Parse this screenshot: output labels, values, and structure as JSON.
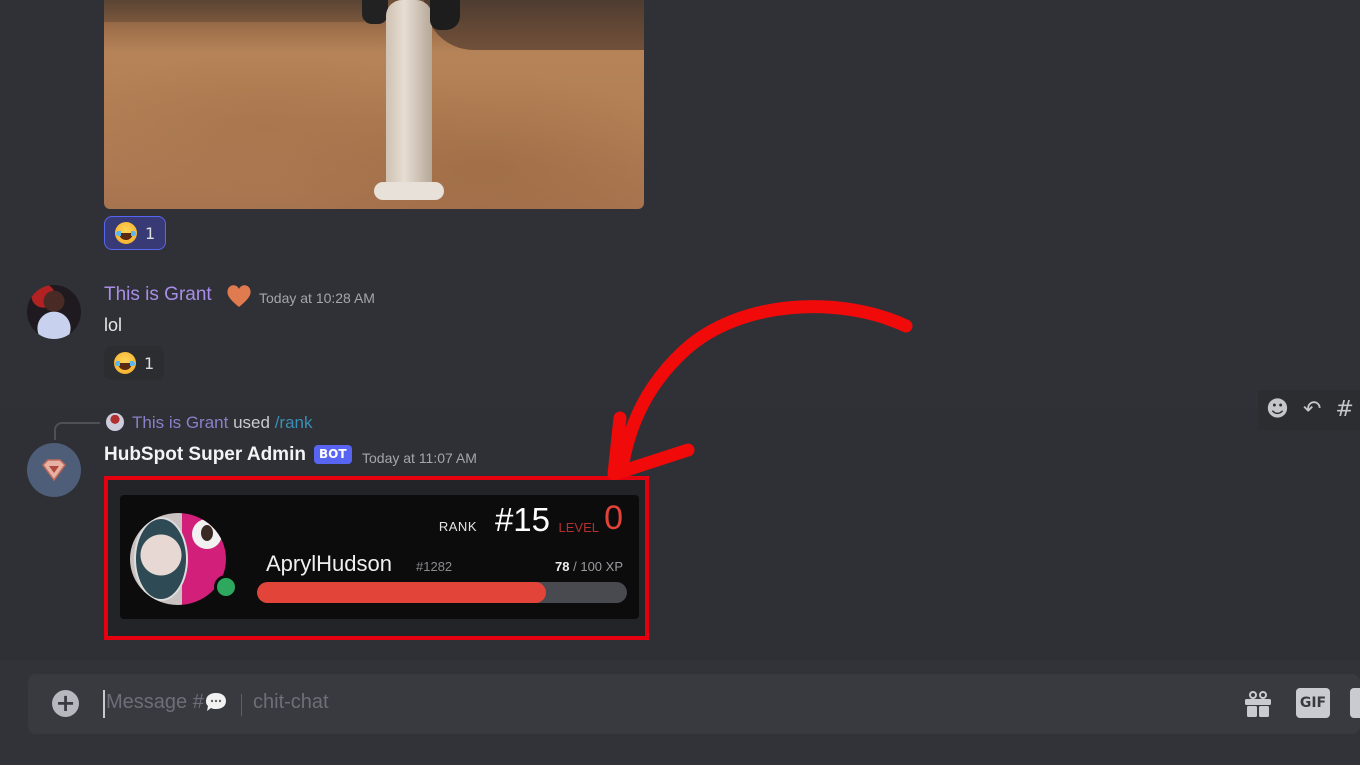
{
  "messages": {
    "gif_reaction": {
      "emoji": "joy-emoji",
      "count": "1"
    },
    "grant_message": {
      "author": "This is Grant",
      "author_badge": "orange-heart-icon",
      "timestamp": "Today at 10:28 AM",
      "text": "lol",
      "reaction": {
        "emoji": "joy-emoji",
        "count": "1"
      }
    },
    "bot_message": {
      "reply": {
        "user": "This is Grant",
        "used": "used",
        "command": "/rank"
      },
      "author": "HubSpot Super Admin",
      "tag": "BOT",
      "timestamp": "Today at 11:07 AM",
      "rank_card": {
        "rank_label": "RANK",
        "rank_value": "#15",
        "level_label": "LEVEL",
        "level_value": "0",
        "username": "AprylHudson",
        "discriminator": "#1282",
        "xp_current": "78",
        "xp_total": "/ 100 XP",
        "xp_fraction": 0.78,
        "status": "online"
      }
    }
  },
  "hover_actions": [
    "add-reaction-icon",
    "reply-icon",
    "thread-icon"
  ],
  "composer": {
    "placeholder_prefix": "Message #",
    "placeholder_channel": "chit-chat",
    "gif_label": "GIF"
  },
  "colors": {
    "accent": "#5865f2",
    "highlight": "#e4000f",
    "xp_fill": "#e2443a",
    "online": "#2ea85e"
  }
}
